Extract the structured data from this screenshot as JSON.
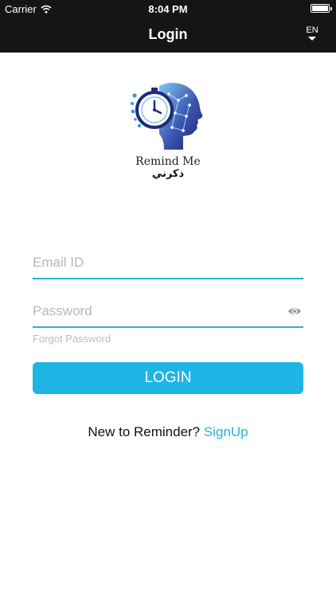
{
  "status_bar": {
    "carrier": "Carrier",
    "time": "8:04 PM",
    "wifi_icon": "wifi-icon",
    "battery_icon": "battery-icon"
  },
  "nav": {
    "title": "Login",
    "language": "EN",
    "language_icon": "chevron-down-icon"
  },
  "logo": {
    "name": "Remind Me",
    "name_ar": "ذكرني",
    "icon": "clock-head-icon"
  },
  "form": {
    "email": {
      "placeholder": "Email ID",
      "value": ""
    },
    "password": {
      "placeholder": "Password",
      "value": "",
      "toggle_icon": "eye-icon"
    },
    "forgot_label": "Forgot Password",
    "login_label": "LOGIN"
  },
  "signup": {
    "prompt": "New to Reminder? ",
    "link_label": "SignUp"
  },
  "colors": {
    "accent": "#1eb5e4",
    "topbar": "#151515",
    "field_line": "#20b5d9",
    "placeholder": "#b7b7b7"
  }
}
